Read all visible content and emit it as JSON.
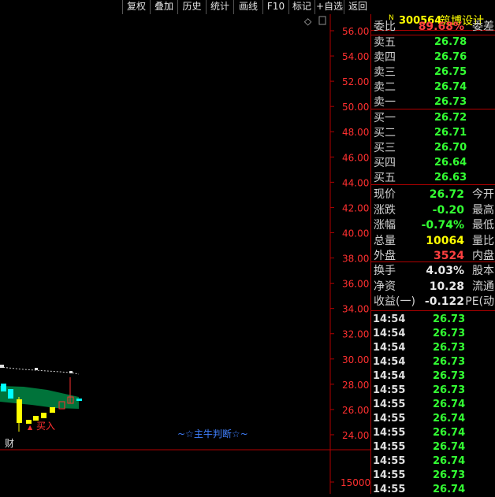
{
  "toolbar": {
    "buttons": [
      "复权",
      "叠加",
      "历史",
      "统计",
      "画线",
      "F10",
      "标记",
      "+自选",
      "返回"
    ]
  },
  "chart": {
    "y_axis_labels": [
      "56.00",
      "54.00",
      "52.00",
      "50.00",
      "48.00",
      "46.00",
      "44.00",
      "42.00",
      "40.00",
      "38.00",
      "36.00",
      "34.00",
      "32.00",
      "30.00",
      "28.00",
      "26.00",
      "24.00"
    ],
    "volume_axis_label": "15000",
    "buy_signal_label": "买入",
    "indicator_label": "~☆主牛判断☆~",
    "finance_label": "财",
    "diamond_icon": "◇",
    "colors": {
      "axis": "#b00000",
      "label": "#ff3030",
      "bull": "#ffff00",
      "bear": "#00ffff",
      "band": "#008040"
    }
  },
  "stock": {
    "badge": "N",
    "code": "300564",
    "name": "筑博设计"
  },
  "ratio": {
    "label": "委比",
    "value": "89.68%",
    "right_label": "委差"
  },
  "sell_orders": [
    {
      "label": "卖五",
      "price": "26.78"
    },
    {
      "label": "卖四",
      "price": "26.76"
    },
    {
      "label": "卖三",
      "price": "26.75"
    },
    {
      "label": "卖二",
      "price": "26.74"
    },
    {
      "label": "卖一",
      "price": "26.73"
    }
  ],
  "buy_orders": [
    {
      "label": "买一",
      "price": "26.72"
    },
    {
      "label": "买二",
      "price": "26.71"
    },
    {
      "label": "买三",
      "price": "26.70"
    },
    {
      "label": "买四",
      "price": "26.64"
    },
    {
      "label": "买五",
      "price": "26.63"
    }
  ],
  "quote": {
    "price": {
      "label": "现价",
      "value": "26.72",
      "right_label": "今开"
    },
    "change": {
      "label": "涨跌",
      "value": "-0.20",
      "right_label": "最高"
    },
    "pct": {
      "label": "涨幅",
      "value": "-0.74%",
      "right_label": "最低"
    },
    "volume": {
      "label": "总量",
      "value": "10064",
      "right_label": "量比"
    },
    "outer": {
      "label": "外盘",
      "value": "3524",
      "right_label": "内盘"
    }
  },
  "fundamentals": {
    "turnover": {
      "label": "换手",
      "value": "4.03%",
      "right_label": "股本"
    },
    "nav": {
      "label": "净资",
      "value": "10.28",
      "right_label": "流通"
    },
    "eps": {
      "label": "收益(一)",
      "value": "-0.122",
      "right_label": "PE(动"
    }
  },
  "ticks": [
    {
      "time": "14:54",
      "price": "26.73"
    },
    {
      "time": "14:54",
      "price": "26.73"
    },
    {
      "time": "14:54",
      "price": "26.73"
    },
    {
      "time": "14:54",
      "price": "26.73"
    },
    {
      "time": "14:54",
      "price": "26.73"
    },
    {
      "time": "14:55",
      "price": "26.73"
    },
    {
      "time": "14:55",
      "price": "26.74"
    },
    {
      "time": "14:55",
      "price": "26.74"
    },
    {
      "time": "14:55",
      "price": "26.74"
    },
    {
      "time": "14:55",
      "price": "26.74"
    },
    {
      "time": "14:55",
      "price": "26.74"
    },
    {
      "time": "14:55",
      "price": "26.73"
    },
    {
      "time": "14:55",
      "price": "26.74"
    }
  ]
}
